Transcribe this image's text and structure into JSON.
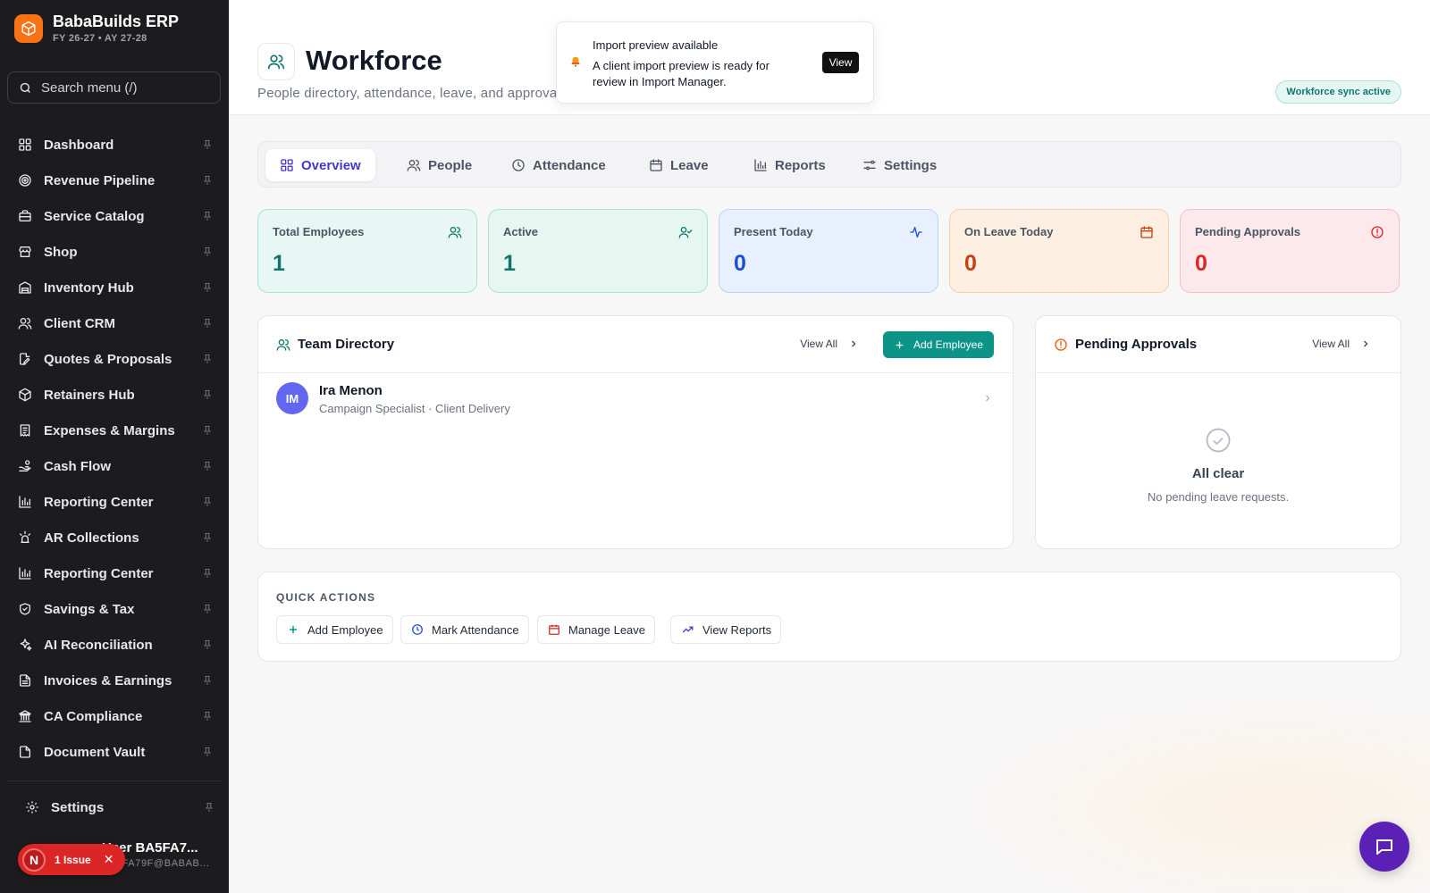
{
  "brand": {
    "name": "BabaBuilds ERP",
    "subtitle": "FY 26-27 • AY 27-28",
    "logo_icon": "box-icon",
    "accent": "#f97316"
  },
  "search": {
    "placeholder": "Search menu (/)"
  },
  "sidebar": {
    "items": [
      {
        "label": "Dashboard",
        "icon": "grid-icon"
      },
      {
        "label": "Revenue Pipeline",
        "icon": "target-icon"
      },
      {
        "label": "Service Catalog",
        "icon": "briefcase-icon"
      },
      {
        "label": "Shop",
        "icon": "store-icon"
      },
      {
        "label": "Inventory Hub",
        "icon": "warehouse-icon"
      },
      {
        "label": "Client CRM",
        "icon": "users-icon"
      },
      {
        "label": "Quotes & Proposals",
        "icon": "file-edit-icon"
      },
      {
        "label": "Retainers Hub",
        "icon": "box-icon"
      },
      {
        "label": "Expenses & Margins",
        "icon": "receipt-icon"
      },
      {
        "label": "Cash Flow",
        "icon": "hand-coins-icon"
      },
      {
        "label": "Reporting Center",
        "icon": "bar-chart-icon"
      },
      {
        "label": "AR Collections",
        "icon": "alarm-icon"
      },
      {
        "label": "Reporting Center",
        "icon": "bar-chart-icon"
      },
      {
        "label": "Savings & Tax",
        "icon": "shield-icon"
      },
      {
        "label": "AI Reconciliation",
        "icon": "sparkles-icon"
      },
      {
        "label": "Invoices & Earnings",
        "icon": "file-text-icon"
      },
      {
        "label": "CA Compliance",
        "icon": "landmark-icon"
      },
      {
        "label": "Document Vault",
        "icon": "file-icon"
      }
    ],
    "settings_label": "Settings",
    "user_name": "User BA5FA7...",
    "user_email": "BA5FA79F@BABAB...",
    "issue_letter": "N",
    "issue_label": "1 Issue"
  },
  "header": {
    "title": "Workforce",
    "subtitle": "People directory, attendance, leave, and approvals",
    "sync_badge": "Workforce sync active",
    "icon": "users-icon"
  },
  "toast": {
    "title": "Import preview available",
    "body": "A client import preview is ready for review in Import Manager.",
    "button": "View",
    "icon": "bell-icon"
  },
  "tabs": [
    {
      "label": "Overview",
      "icon": "grid-icon",
      "active": true
    },
    {
      "label": "People",
      "icon": "users-icon",
      "active": false
    },
    {
      "label": "Attendance",
      "icon": "clock-icon",
      "active": false
    },
    {
      "label": "Leave",
      "icon": "calendar-icon",
      "active": false
    },
    {
      "label": "Reports",
      "icon": "bar-chart-icon",
      "active": false
    },
    {
      "label": "Settings",
      "icon": "sliders-icon",
      "active": false
    }
  ],
  "stats": [
    {
      "label": "Total Employees",
      "value": "1",
      "icon": "users-icon",
      "color": "#0f766e",
      "bg": "#e8f7f4",
      "border": "#a7e3d8"
    },
    {
      "label": "Active",
      "value": "1",
      "icon": "user-check-icon",
      "color": "#0f766e",
      "bg": "#e6f6f1",
      "border": "#a7e3d8"
    },
    {
      "label": "Present Today",
      "value": "0",
      "icon": "activity-icon",
      "color": "#1d4ed8",
      "bg": "#e8f0fe",
      "border": "#bcd2f7"
    },
    {
      "label": "On Leave Today",
      "value": "0",
      "icon": "calendar-icon",
      "color": "#c2410c",
      "bg": "#fdf0e3",
      "border": "#f8cfa8"
    },
    {
      "label": "Pending Approvals",
      "value": "0",
      "icon": "alert-circle-icon",
      "color": "#dc2626",
      "bg": "#fde8ec",
      "border": "#f7c0cb"
    }
  ],
  "team_directory": {
    "title": "Team Directory",
    "view_all": "View All",
    "add_button": "Add Employee",
    "employees": [
      {
        "initials": "IM",
        "name": "Ira Menon",
        "role": "Campaign Specialist · Client Delivery"
      }
    ]
  },
  "pending_approvals": {
    "title": "Pending Approvals",
    "view_all": "View All",
    "empty_title": "All clear",
    "empty_sub": "No pending leave requests."
  },
  "quick_actions": {
    "title": "QUICK ACTIONS",
    "buttons": [
      {
        "label": "Add Employee",
        "icon": "plus-icon"
      },
      {
        "label": "Mark Attendance",
        "icon": "clock-icon"
      },
      {
        "label": "Manage Leave",
        "icon": "calendar-icon"
      },
      {
        "label": "View Reports",
        "icon": "trending-up-icon"
      }
    ]
  }
}
